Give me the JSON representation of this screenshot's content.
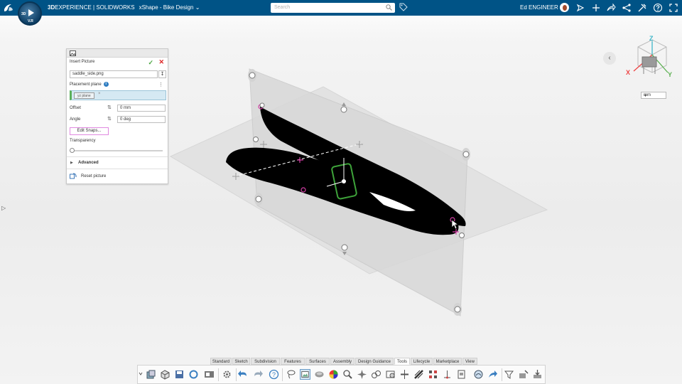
{
  "topbar": {
    "brand_bold": "3D",
    "brand_rest": "EXPERIENCE | SOLIDWORKS",
    "app_context": "xShape - Bike Design",
    "search_placeholder": "Search",
    "user_name": "Ed ENGINEER",
    "compass_labels": [
      "3D",
      "V.R"
    ],
    "accent_color": "#005386"
  },
  "panel": {
    "title": "Insert Picture",
    "file_name": "saddle_side.png",
    "placement_plane_label": "Placement plane",
    "placement_plane_value": "yz plane",
    "offset_label": "Offset",
    "offset_value": "0 mm",
    "angle_label": "Angle",
    "angle_value": "0 deg",
    "edit_snaps_label": "Edit Snaps...",
    "transparency_label": "Transparency",
    "transparency_value": 0,
    "advanced_label": "Advanced",
    "reset_label": "Reset picture"
  },
  "viewport": {
    "units": "mm",
    "view_cube_axes": [
      "Z",
      "X",
      "Y"
    ]
  },
  "bottom_tabs": [
    "Standard",
    "Sketch",
    "Subdivision",
    "Features",
    "Surfaces",
    "Assembly",
    "Design Guidance",
    "Tools",
    "Lifecycle",
    "Marketplace",
    "View"
  ],
  "active_tab": "Tools",
  "tools": [
    "expand-icon",
    "part-icon",
    "box-icon",
    "save-icon",
    "rebuild-icon",
    "presentation-icon",
    "settings-icon",
    "undo-icon",
    "redo-icon",
    "help-icon",
    "lasso-icon",
    "insert-picture-icon",
    "shape-icon",
    "appearance-icon",
    "zoom-icon",
    "inspect-icon",
    "measure-icon",
    "analysis-icon",
    "section-icon",
    "mirror-icon",
    "texture-icon",
    "pattern-icon",
    "align-icon",
    "document-icon",
    "render-icon",
    "share-icon",
    "filter-icon",
    "configure-icon",
    "export-icon"
  ]
}
